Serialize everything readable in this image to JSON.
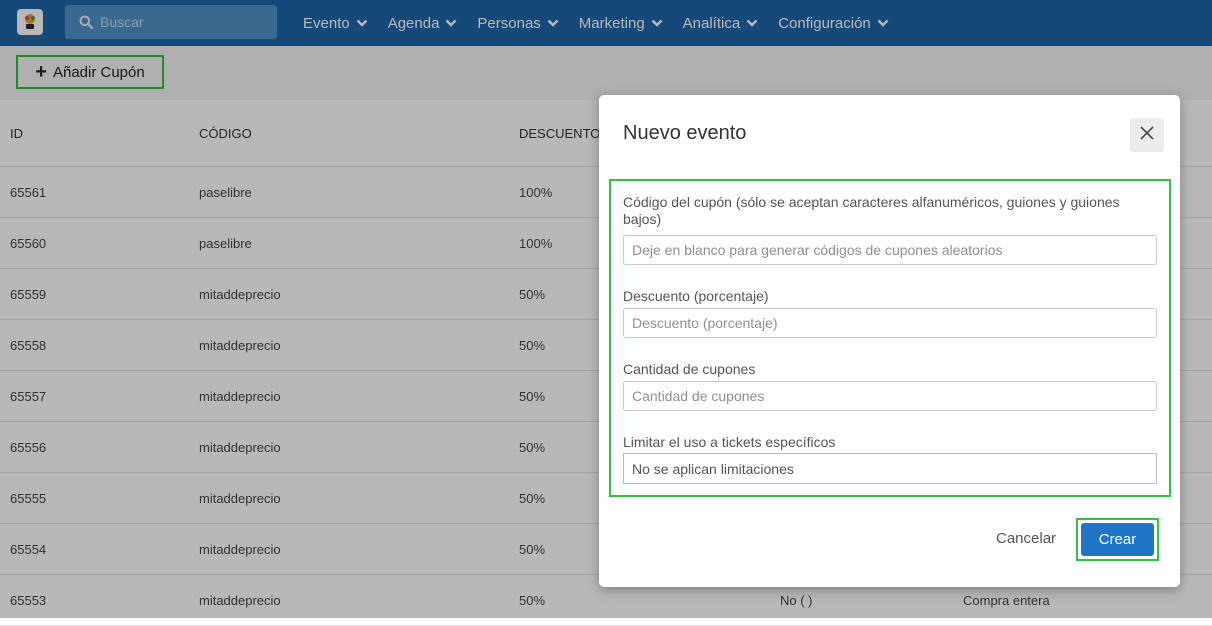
{
  "colors": {
    "navbar": "#1e66a8",
    "accent": "#1f76c8",
    "highlight": "#33c046"
  },
  "navbar": {
    "logo_icon": "app-logo",
    "search_placeholder": "Buscar",
    "items": [
      {
        "label": "Evento"
      },
      {
        "label": "Agenda"
      },
      {
        "label": "Personas"
      },
      {
        "label": "Marketing"
      },
      {
        "label": "Analítica"
      },
      {
        "label": "Configuración"
      }
    ]
  },
  "toolbar": {
    "add_label": "Añadir Cupón"
  },
  "table": {
    "headers": [
      "ID",
      "CÓDIGO",
      "DESCUENTO"
    ],
    "rows": [
      {
        "id": "65561",
        "code": "paselibre",
        "discount": "100%"
      },
      {
        "id": "65560",
        "code": "paselibre",
        "discount": "100%"
      },
      {
        "id": "65559",
        "code": "mitaddeprecio",
        "discount": "50%"
      },
      {
        "id": "65558",
        "code": "mitaddeprecio",
        "discount": "50%"
      },
      {
        "id": "65557",
        "code": "mitaddeprecio",
        "discount": "50%"
      },
      {
        "id": "65556",
        "code": "mitaddeprecio",
        "discount": "50%"
      },
      {
        "id": "65555",
        "code": "mitaddeprecio",
        "discount": "50%"
      },
      {
        "id": "65554",
        "code": "mitaddeprecio",
        "discount": "50%"
      },
      {
        "id": "65553",
        "code": "mitaddeprecio",
        "discount": "50%",
        "limit": "No ( )",
        "type": "Compra entera"
      }
    ]
  },
  "modal": {
    "title": "Nuevo evento",
    "code_label": "Código del cupón (sólo se aceptan caracteres alfanuméricos, guiones y guiones bajos)",
    "code_placeholder": "Deje en blanco para generar códigos de cupones aleatorios",
    "discount_label": "Descuento (porcentaje)",
    "discount_placeholder": "Descuento (porcentaje)",
    "quantity_label": "Cantidad de cupones",
    "quantity_placeholder": "Cantidad de cupones",
    "limit_label": "Limitar el uso a tickets específicos",
    "limit_value": "No se aplican limitaciones",
    "cancel_label": "Cancelar",
    "create_label": "Crear"
  }
}
